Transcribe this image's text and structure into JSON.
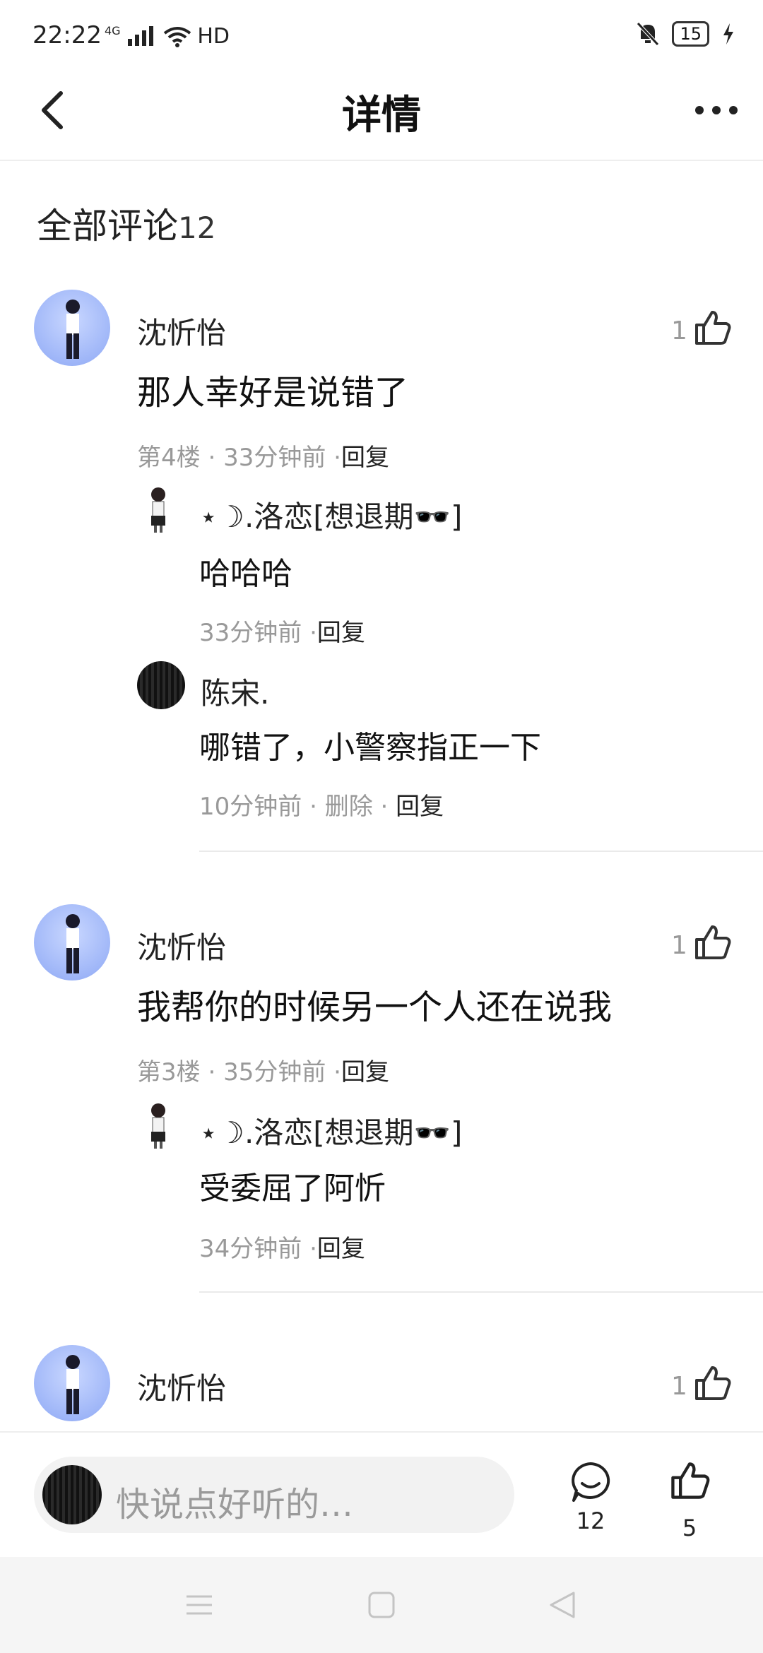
{
  "status_bar": {
    "time": "22:22",
    "network": "4G",
    "hd": "HD",
    "battery": "15"
  },
  "header": {
    "title": "详情"
  },
  "comments_section": {
    "title": "全部评论",
    "count": "12"
  },
  "comments": [
    {
      "author": "沈忻怡",
      "text": "那人幸好是说错了",
      "floor": "第4楼",
      "time": "33分钟前",
      "reply_label": "回复",
      "likes": "1",
      "replies": [
        {
          "author": "⋆☽.洛恋[想退期🕶️]",
          "text": "哈哈哈",
          "time": "33分钟前",
          "reply_label": "回复"
        },
        {
          "author": "陈宋.",
          "text": "哪错了，小警察指正一下",
          "time": "10分钟前",
          "delete_label": "删除",
          "reply_label": "回复"
        }
      ]
    },
    {
      "author": "沈忻怡",
      "text": "我帮你的时候另一个人还在说我",
      "floor": "第3楼",
      "time": "35分钟前",
      "reply_label": "回复",
      "likes": "1",
      "replies": [
        {
          "author": "⋆☽.洛恋[想退期🕶️]",
          "text": "受委屈了阿忻",
          "time": "34分钟前",
          "reply_label": "回复"
        }
      ]
    },
    {
      "author": "沈忻怡",
      "likes": "1"
    }
  ],
  "bottom_bar": {
    "input_placeholder": "快说点好听的…",
    "comment_count": "12",
    "like_count": "5"
  }
}
